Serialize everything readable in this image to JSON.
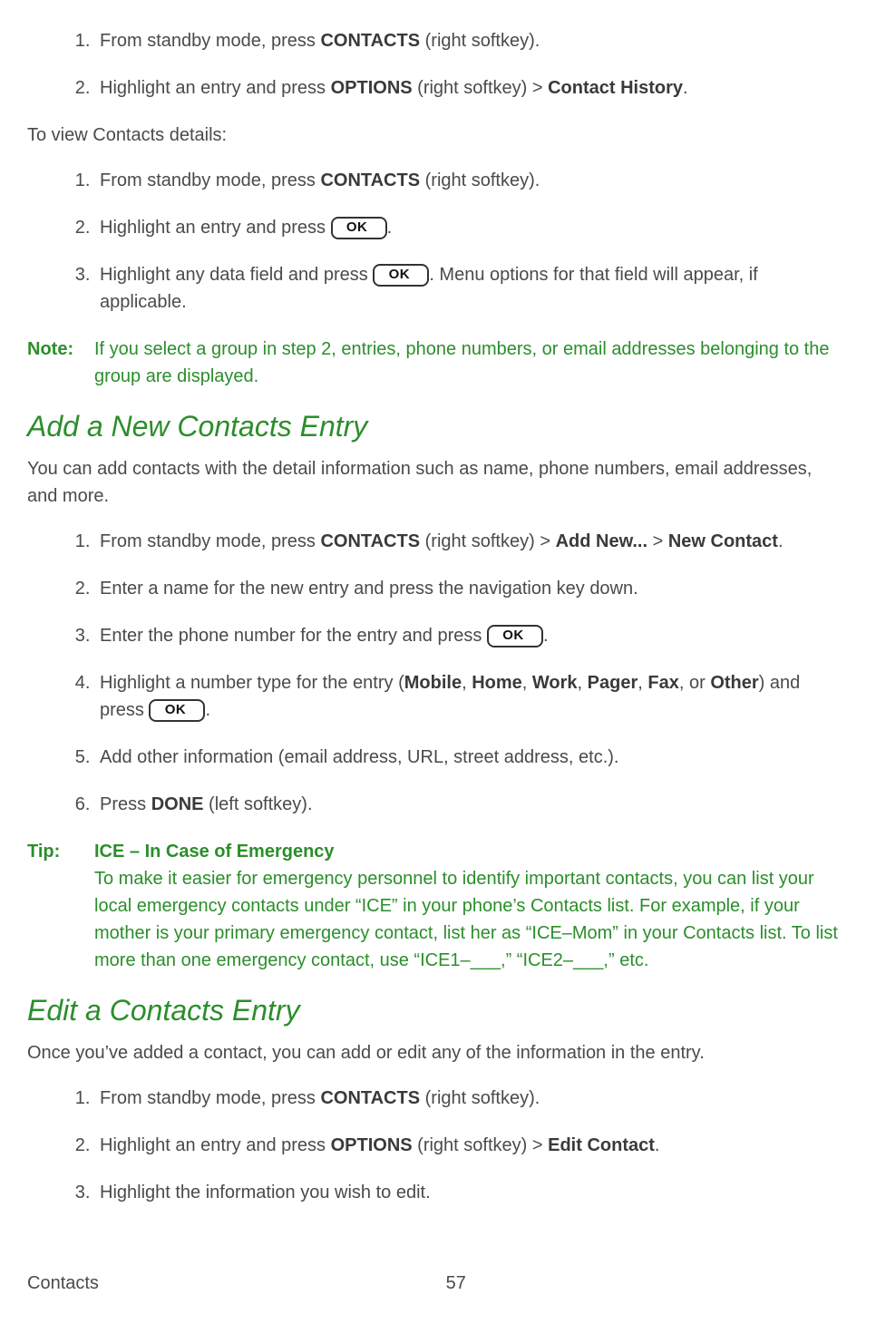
{
  "list1": {
    "item1": {
      "pre": "From standby mode, press ",
      "bold": "CONTACTS",
      "post": " (right softkey)."
    },
    "item2": {
      "pre": "Highlight an entry and press ",
      "bold1": "OPTIONS",
      "mid": " (right softkey) > ",
      "bold2": "Contact History",
      "post": "."
    }
  },
  "details_intro": "To view Contacts details:",
  "list2": {
    "item1": {
      "pre": "From standby mode, press ",
      "bold": "CONTACTS",
      "post": " (right softkey)."
    },
    "item2": {
      "pre": "Highlight an entry and press ",
      "btn": "OK",
      "post": "."
    },
    "item3": {
      "pre": "Highlight any data field and press ",
      "btn": "OK",
      "post": ". Menu options for that field will appear, if applicable."
    }
  },
  "note": {
    "label": "Note:",
    "body": "If you select a group in step 2, entries, phone numbers, or email addresses belonging to the group are displayed."
  },
  "section_add": {
    "heading": "Add a New Contacts Entry",
    "intro": "You can add contacts with the detail information such as name, phone numbers, email addresses, and more."
  },
  "list3": {
    "item1": {
      "pre": "From standby mode, press ",
      "bold1": "CONTACTS",
      "mid1": " (right softkey) > ",
      "bold2": "Add New...",
      "mid2": " > ",
      "bold3": "New Contact",
      "post": "."
    },
    "item2": "Enter a name for the new entry and press the navigation key down.",
    "item3": {
      "pre": "Enter the phone number for the entry and press ",
      "btn": "OK",
      "post": "."
    },
    "item4": {
      "pre": "Highlight a number type for the entry (",
      "b1": "Mobile",
      "c1": ", ",
      "b2": "Home",
      "c2": ", ",
      "b3": "Work",
      "c3": ", ",
      "b4": "Pager",
      "c4": ", ",
      "b5": "Fax",
      "c5": ", or ",
      "b6": "Other",
      "mid": ") and press ",
      "btn": "OK",
      "post": "."
    },
    "item5": "Add other information (email address, URL, street address, etc.).",
    "item6": {
      "pre": "Press ",
      "bold": "DONE",
      "post": " (left softkey)."
    }
  },
  "tip": {
    "label": "Tip:",
    "title": "ICE – In Case of Emergency",
    "body": "To make it easier for emergency personnel to identify important contacts, you can list your local emergency contacts under “ICE” in your phone’s Contacts list. For example, if your mother is your primary emergency contact, list her as “ICE–Mom” in your Contacts list. To list more than one emergency contact, use “ICE1–___,” “ICE2–___,” etc."
  },
  "section_edit": {
    "heading": "Edit a Contacts Entry",
    "intro": "Once you’ve added a contact, you can add or edit any of the information in the entry."
  },
  "list4": {
    "item1": {
      "pre": "From standby mode, press ",
      "bold": "CONTACTS",
      "post": " (right softkey)."
    },
    "item2": {
      "pre": "Highlight an entry and press ",
      "bold1": "OPTIONS",
      "mid": " (right softkey) > ",
      "bold2": "Edit Contact",
      "post": "."
    },
    "item3": "Highlight the information you wish to edit."
  },
  "footer": {
    "section": "Contacts",
    "page": "57"
  }
}
